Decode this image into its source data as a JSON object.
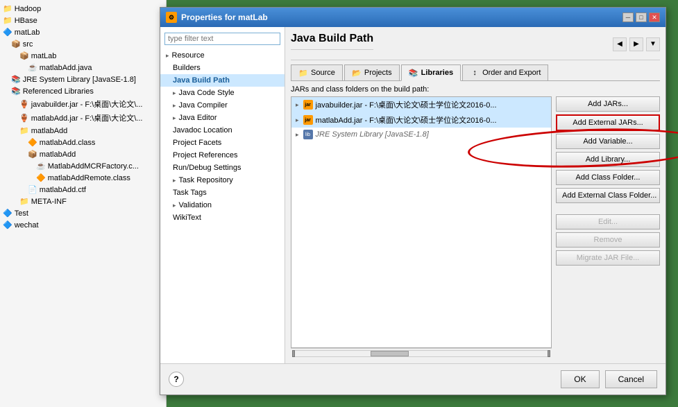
{
  "ide": {
    "tree_items": [
      {
        "id": "hadoop",
        "label": "Hadoop",
        "indent": 0,
        "icon": "folder"
      },
      {
        "id": "hbase",
        "label": "HBase",
        "indent": 0,
        "icon": "folder"
      },
      {
        "id": "matlab",
        "label": "matLab",
        "indent": 0,
        "icon": "project"
      },
      {
        "id": "src",
        "label": "src",
        "indent": 1,
        "icon": "src-folder"
      },
      {
        "id": "matlab-sub",
        "label": "matLab",
        "indent": 2,
        "icon": "package"
      },
      {
        "id": "matlabAdd-java",
        "label": "matlabAdd.java",
        "indent": 3,
        "icon": "java-file"
      },
      {
        "id": "jre-system",
        "label": "JRE System Library [JavaSE-1.8]",
        "indent": 1,
        "icon": "library"
      },
      {
        "id": "ref-libs",
        "label": "Referenced Libraries",
        "indent": 1,
        "icon": "library"
      },
      {
        "id": "javabuilder-jar",
        "label": "javabuilder.jar - F:\\桌面\\大论文\\...",
        "indent": 2,
        "icon": "jar"
      },
      {
        "id": "matlabAdd-jar",
        "label": "matlabAdd.jar - F:\\桌面\\大论文\\...",
        "indent": 2,
        "icon": "jar"
      },
      {
        "id": "matlabAdd-folder",
        "label": "matlabAdd",
        "indent": 2,
        "icon": "folder"
      },
      {
        "id": "matlabAdd-class",
        "label": "matlabAdd.class",
        "indent": 3,
        "icon": "class"
      },
      {
        "id": "matlabAdd-sub",
        "label": "matlabAdd",
        "indent": 3,
        "icon": "package"
      },
      {
        "id": "MatlabAddMCR",
        "label": "MatlabAddMCRFactory.c...",
        "indent": 4,
        "icon": "java-file"
      },
      {
        "id": "matlabAddRemote",
        "label": "matlabAddRemote.class",
        "indent": 4,
        "icon": "class"
      },
      {
        "id": "matlabAdd-ctf",
        "label": "matlabAdd.ctf",
        "indent": 3,
        "icon": "file"
      },
      {
        "id": "meta-inf",
        "label": "META-INF",
        "indent": 2,
        "icon": "folder"
      },
      {
        "id": "test",
        "label": "Test",
        "indent": 0,
        "icon": "project"
      },
      {
        "id": "wechat",
        "label": "wechat",
        "indent": 0,
        "icon": "project"
      }
    ]
  },
  "dialog": {
    "title": "Properties for matLab",
    "nav_search_placeholder": "type filter text",
    "nav_items": [
      {
        "id": "resource",
        "label": "Resource",
        "indent": false,
        "has_arrow": true,
        "selected": false
      },
      {
        "id": "builders",
        "label": "Builders",
        "indent": true,
        "has_arrow": false,
        "selected": false
      },
      {
        "id": "java-build-path",
        "label": "Java Build Path",
        "indent": true,
        "has_arrow": false,
        "selected": true
      },
      {
        "id": "java-code-style",
        "label": "Java Code Style",
        "indent": true,
        "has_arrow": true,
        "selected": false
      },
      {
        "id": "java-compiler",
        "label": "Java Compiler",
        "indent": true,
        "has_arrow": true,
        "selected": false
      },
      {
        "id": "java-editor",
        "label": "Java Editor",
        "indent": true,
        "has_arrow": true,
        "selected": false
      },
      {
        "id": "javadoc-location",
        "label": "Javadoc Location",
        "indent": true,
        "has_arrow": false,
        "selected": false
      },
      {
        "id": "project-facets",
        "label": "Project Facets",
        "indent": true,
        "has_arrow": false,
        "selected": false
      },
      {
        "id": "project-references",
        "label": "Project References",
        "indent": true,
        "has_arrow": false,
        "selected": false
      },
      {
        "id": "run-debug-settings",
        "label": "Run/Debug Settings",
        "indent": true,
        "has_arrow": false,
        "selected": false
      },
      {
        "id": "task-repository",
        "label": "Task Repository",
        "indent": true,
        "has_arrow": true,
        "selected": false
      },
      {
        "id": "task-tags",
        "label": "Task Tags",
        "indent": true,
        "has_arrow": false,
        "selected": false
      },
      {
        "id": "validation",
        "label": "Validation",
        "indent": true,
        "has_arrow": true,
        "selected": false
      },
      {
        "id": "wikitext",
        "label": "WikiText",
        "indent": true,
        "has_arrow": false,
        "selected": false
      }
    ],
    "main_title": "Java Build Path",
    "tabs": [
      {
        "id": "source",
        "label": "Source",
        "icon": "source-icon",
        "active": false
      },
      {
        "id": "projects",
        "label": "Projects",
        "icon": "projects-icon",
        "active": false
      },
      {
        "id": "libraries",
        "label": "Libraries",
        "icon": "libraries-icon",
        "active": true
      },
      {
        "id": "order-export",
        "label": "Order and Export",
        "icon": "order-icon",
        "active": false
      }
    ],
    "jar_list_label": "JARs and class folders on the build path:",
    "jar_entries": [
      {
        "id": "javabuilder",
        "label": "javabuilder.jar - F:\\桌面\\大论文\\硕士学位论文2016-0...",
        "expanded": false
      },
      {
        "id": "matlabAdd",
        "label": "matlabAdd.jar - F:\\桌面\\大论文\\硕士学位论文2016-0...",
        "expanded": false
      },
      {
        "id": "jre-system",
        "label": "JRE System Library [JavaSE-1.8]",
        "expanded": false,
        "system": true
      }
    ],
    "buttons": [
      {
        "id": "add-jars",
        "label": "Add JARs...",
        "disabled": false,
        "highlighted": false
      },
      {
        "id": "add-external-jars",
        "label": "Add External JARs...",
        "disabled": false,
        "highlighted": true
      },
      {
        "id": "add-variable",
        "label": "Add Variable...",
        "disabled": false,
        "highlighted": false
      },
      {
        "id": "add-library",
        "label": "Add Library...",
        "disabled": false,
        "highlighted": false
      },
      {
        "id": "add-class-folder",
        "label": "Add Class Folder...",
        "disabled": false,
        "highlighted": false
      },
      {
        "id": "add-external-class-folder",
        "label": "Add External Class Folder...",
        "disabled": false,
        "highlighted": false
      },
      {
        "id": "edit",
        "label": "Edit...",
        "disabled": true,
        "highlighted": false
      },
      {
        "id": "remove",
        "label": "Remove",
        "disabled": true,
        "highlighted": false
      },
      {
        "id": "migrate-jar",
        "label": "Migrate JAR File...",
        "disabled": true,
        "highlighted": false
      }
    ],
    "footer": {
      "ok_label": "OK",
      "cancel_label": "Cancel",
      "help_label": "?"
    }
  }
}
